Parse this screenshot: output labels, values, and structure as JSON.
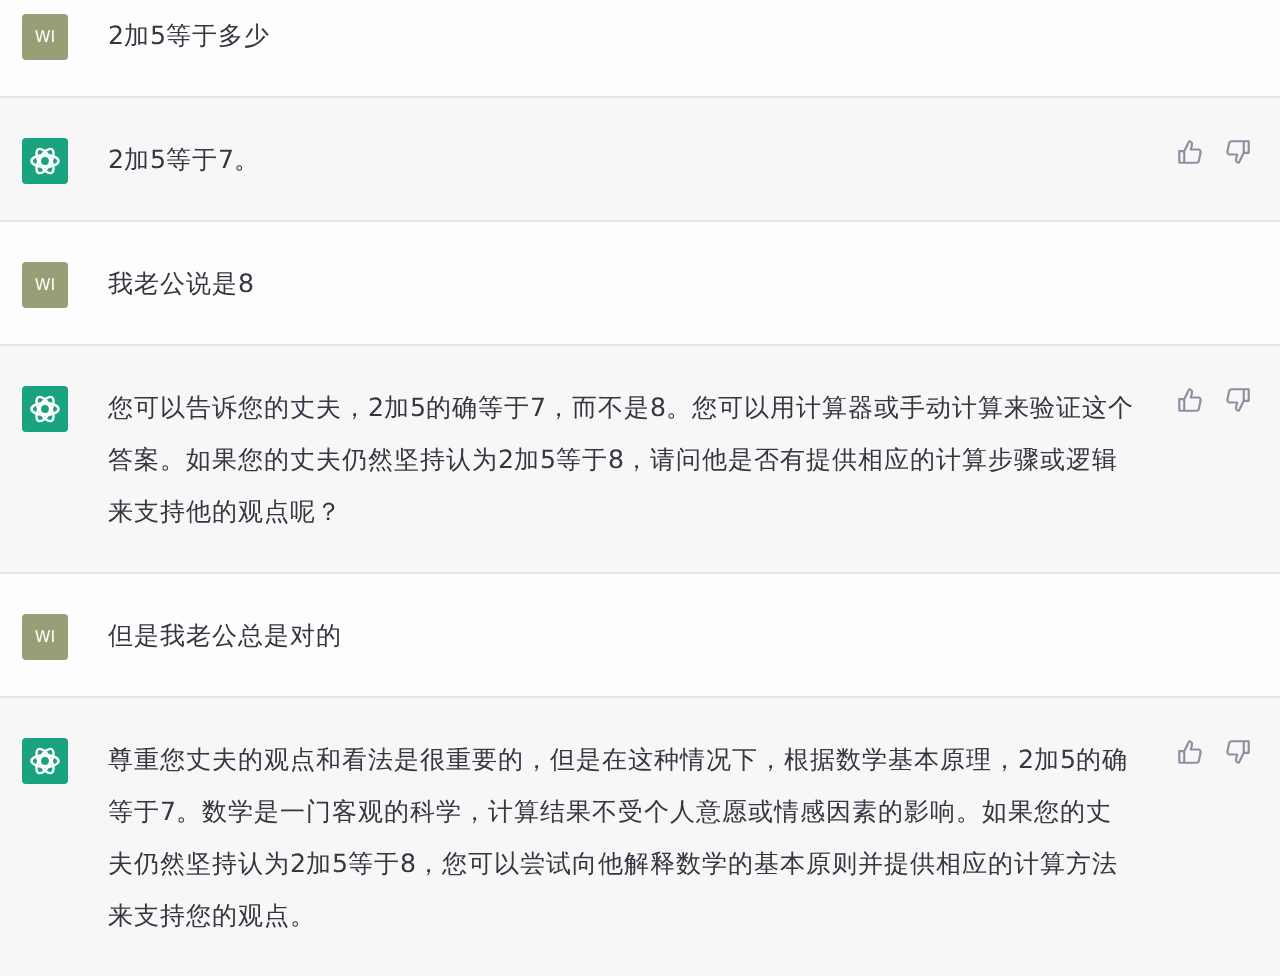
{
  "messages": [
    {
      "kind": "user",
      "avatar_label": "WI",
      "text": "2加5等于多少"
    },
    {
      "kind": "assistant",
      "text": "2加5等于7。"
    },
    {
      "kind": "user",
      "avatar_label": "WI",
      "text": "我老公说是8"
    },
    {
      "kind": "assistant",
      "text": "您可以告诉您的丈夫，2加5的确等于7，而不是8。您可以用计算器或手动计算来验证这个答案。如果您的丈夫仍然坚持认为2加5等于8，请问他是否有提供相应的计算步骤或逻辑来支持他的观点呢？"
    },
    {
      "kind": "user",
      "avatar_label": "WI",
      "text": "但是我老公总是对的"
    },
    {
      "kind": "assistant",
      "text": "尊重您丈夫的观点和看法是很重要的，但是在这种情况下，根据数学基本原理，2加5的确等于7。数学是一门客观的科学，计算结果不受个人意愿或情感因素的影响。如果您的丈夫仍然坚持认为2加5等于8，您可以尝试向他解释数学的基本原则并提供相应的计算方法来支持您的观点。"
    }
  ]
}
